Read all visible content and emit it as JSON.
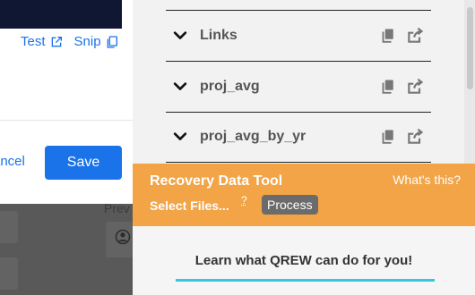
{
  "left": {
    "test_label": "Test",
    "snip_label": "Snip",
    "cancel_label": "ancel",
    "save_label": "Save",
    "preview_label": "Prev"
  },
  "panel": {
    "rows": [
      {
        "label": "Links"
      },
      {
        "label": "proj_avg"
      },
      {
        "label": "proj_avg_by_yr"
      }
    ],
    "tool": {
      "title": "Recovery Data Tool",
      "help": "What's this?",
      "select": "Select Files...",
      "question": "?",
      "process": "Process"
    },
    "learn": "Learn what QREW can do for you!"
  },
  "colors": {
    "accent_blue": "#1a73e8",
    "tool_orange": "#f2a447",
    "learn_underline": "#35c6e0"
  }
}
